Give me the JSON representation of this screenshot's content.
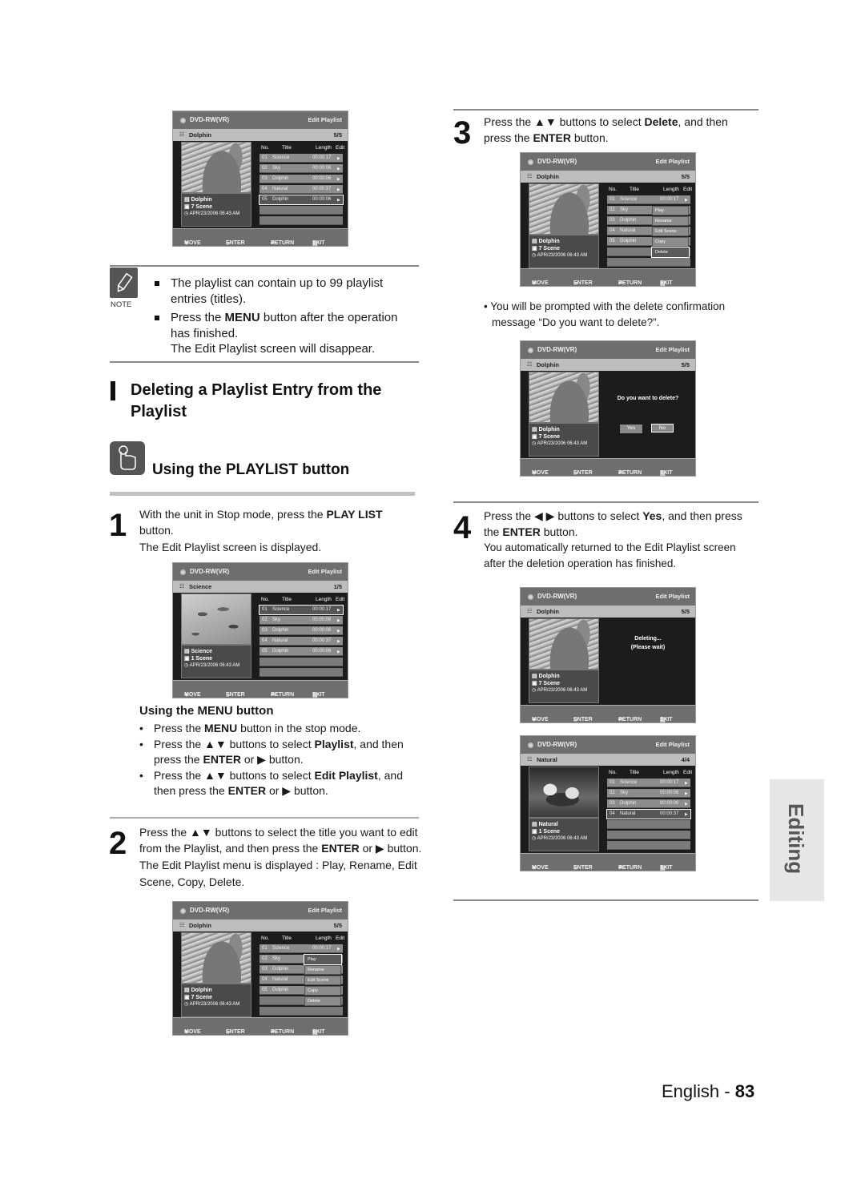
{
  "page": {
    "section_title_line1": "Deleting a Playlist Entry from the",
    "section_title_line2": "Playlist",
    "subsection_title": "Using the PLAYLIST button",
    "side_tab": "Editing",
    "footer_lang": "English - ",
    "footer_page": "83"
  },
  "note": {
    "label": "NOTE",
    "icon": "pencil-icon",
    "item1_line1": "The playlist can contain up to 99 playlist",
    "item1_line2": "entries (titles).",
    "item2_pre": "Press the ",
    "item2_bold": "MENU",
    "item2_post": " button after the operation",
    "item2_line2": "has finished.",
    "item2_line3": "The Edit Playlist screen will disappear."
  },
  "steps": {
    "s1": {
      "num": "1",
      "pre": "With the unit in Stop mode, press the ",
      "bold": "PLAY LIST",
      "line2": "button.",
      "line3": "The Edit Playlist screen is displayed."
    },
    "menu": {
      "title": "Using the MENU button",
      "b1_pre": "Press the ",
      "b1_bold": "MENU",
      "b1_post": " button in the stop mode.",
      "b2_pre": "Press the ▲▼ buttons to select ",
      "b2_bold": "Playlist",
      "b2_post": ", and then",
      "b2_l2_pre": "press the ",
      "b2_l2_bold": "ENTER",
      "b2_l2_post": " or ▶ button.",
      "b3_pre": "Press the ▲▼ buttons to select ",
      "b3_bold": "Edit Playlist",
      "b3_post": ", and",
      "b3_l2_pre": "then press the ",
      "b3_l2_bold": "ENTER",
      "b3_l2_post": " or ▶ button."
    },
    "s2": {
      "num": "2",
      "line1": "Press the ▲▼ buttons to select the title you want to edit",
      "l2_pre": "from the Playlist, and then press the ",
      "l2_bold": "ENTER",
      "l2_post": " or ▶ button.",
      "line3": "The Edit Playlist menu is displayed : Play, Rename, Edit",
      "line4": "Scene, Copy, Delete."
    },
    "s3": {
      "num": "3",
      "pre": "Press the ▲▼ buttons to select ",
      "bold": "Delete",
      "post": ", and then",
      "l2_pre": "press the ",
      "l2_bold": "ENTER",
      "l2_post": " button.",
      "bullet_line1": "• You will be prompted with the delete confirmation",
      "bullet_line2": "message “Do you want to delete?”."
    },
    "s4": {
      "num": "4",
      "pre": "Press the ◀ ▶ buttons to select ",
      "bold": "Yes",
      "post": ", and then press",
      "l2_pre": "the ",
      "l2_bold": "ENTER",
      "l2_post": " button.",
      "line3": "You automatically returned to the Edit Playlist screen",
      "line4": "after the deletion operation has finished."
    }
  },
  "screen_common": {
    "disc": "DVD-RW(VR)",
    "mode": "Edit Playlist",
    "col_no": "No.",
    "col_title": "Title",
    "col_length": "Length",
    "col_edit": "Edit",
    "footer_move": "MOVE",
    "footer_enter": "ENTER",
    "footer_return": "RETURN",
    "footer_exit": "EXIT",
    "date": "APR/23/2006 06:43 AM",
    "popup": [
      "Play",
      "Rename",
      "Edit Scene",
      "Copy",
      "Delete"
    ],
    "confirm_msg": "Do you want to delete?",
    "yes": "Yes",
    "no": "No",
    "deleting": "Deleting...",
    "please_wait": "(Please wait)"
  },
  "screens": {
    "top": {
      "title": "Dolphin",
      "count": "5/5",
      "scene": "7 Scene",
      "selected_row": 5
    },
    "step1": {
      "title": "Science",
      "count": "1/5",
      "scene": "1 Scene",
      "selected_row": 1
    },
    "step2": {
      "title": "Dolphin",
      "count": "5/5",
      "scene": "7 Scene",
      "popup_selected": "Play"
    },
    "step3": {
      "title": "Dolphin",
      "count": "5/5",
      "scene": "7 Scene",
      "popup_selected": "Delete"
    },
    "confirm": {
      "title": "Dolphin",
      "count": "5/5",
      "scene": "7 Scene",
      "focused_button": "No"
    },
    "deleting": {
      "title": "Dolphin",
      "count": "5/5",
      "scene": "7 Scene"
    },
    "after": {
      "title": "Natural",
      "count": "4/4",
      "scene": "1 Scene",
      "selected_row": 4
    }
  },
  "rows5": [
    {
      "no": "01",
      "title": "Science",
      "length": "00:00:17"
    },
    {
      "no": "02",
      "title": "Sky",
      "length": "00:00:06"
    },
    {
      "no": "03",
      "title": "Dolphin",
      "length": "00:00:06"
    },
    {
      "no": "04",
      "title": "Natural",
      "length": "00:00:37"
    },
    {
      "no": "05",
      "title": "Dolphin",
      "length": "00:00:06"
    }
  ],
  "rows4": [
    {
      "no": "01",
      "title": "Science",
      "length": "00:00:17"
    },
    {
      "no": "02",
      "title": "Sky",
      "length": "00:00:06"
    },
    {
      "no": "03",
      "title": "Dolphin",
      "length": "00:00:06"
    },
    {
      "no": "04",
      "title": "Natural",
      "length": "00:00:37"
    }
  ]
}
